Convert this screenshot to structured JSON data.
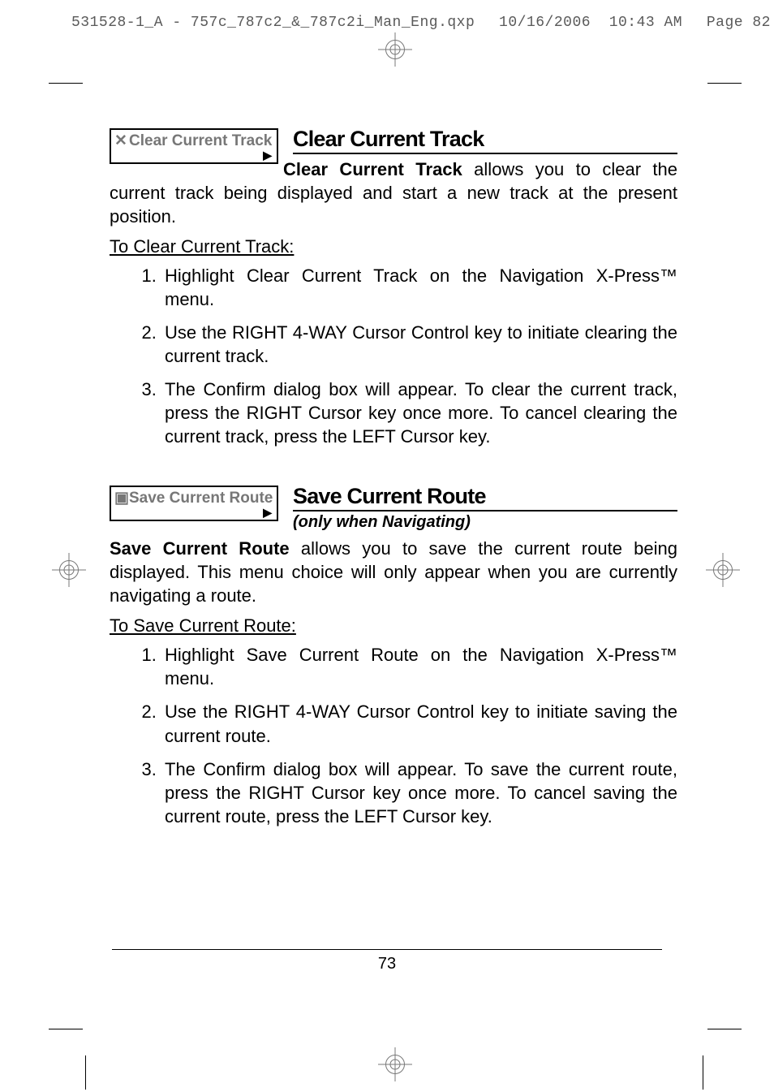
{
  "header": {
    "file": "531528-1_A - 757c_787c2_&_787c2i_Man_Eng.qxp",
    "date": "10/16/2006",
    "time": "10:43 AM",
    "page_label": "Page 82"
  },
  "sections": [
    {
      "menu_icon": "✕",
      "menu_label": "Clear Current Track",
      "title": "Clear Current Track",
      "subtitle": "",
      "lead_strong": "Clear Current Track",
      "lead_rest": " allows you to clear the current track being displayed and start a new track at the present position.",
      "procedure_label": "To Clear Current Track:",
      "steps": [
        "Highlight Clear Current Track on the Navigation X-Press™ menu.",
        "Use the RIGHT 4-WAY Cursor Control key to initiate clearing the current track.",
        "The Confirm dialog box will appear. To clear the current track, press the RIGHT Cursor key once more. To cancel clearing the current track, press the LEFT Cursor key."
      ]
    },
    {
      "menu_icon": "▣",
      "menu_label": "Save Current Route",
      "title": "Save Current Route",
      "subtitle": "(only when Navigating)",
      "lead_strong": "Save Current Route",
      "lead_rest": " allows you to save the current route being displayed. This menu choice will only appear when you are currently navigating a route.",
      "procedure_label": "To Save Current Route:",
      "steps": [
        "Highlight Save Current Route on the Navigation X-Press™ menu.",
        "Use the RIGHT 4-WAY Cursor Control key to initiate saving the current route.",
        "The Confirm dialog box will appear. To save the current route, press the RIGHT Cursor key once more. To cancel saving the current route, press the LEFT Cursor key."
      ]
    }
  ],
  "page_number": "73"
}
